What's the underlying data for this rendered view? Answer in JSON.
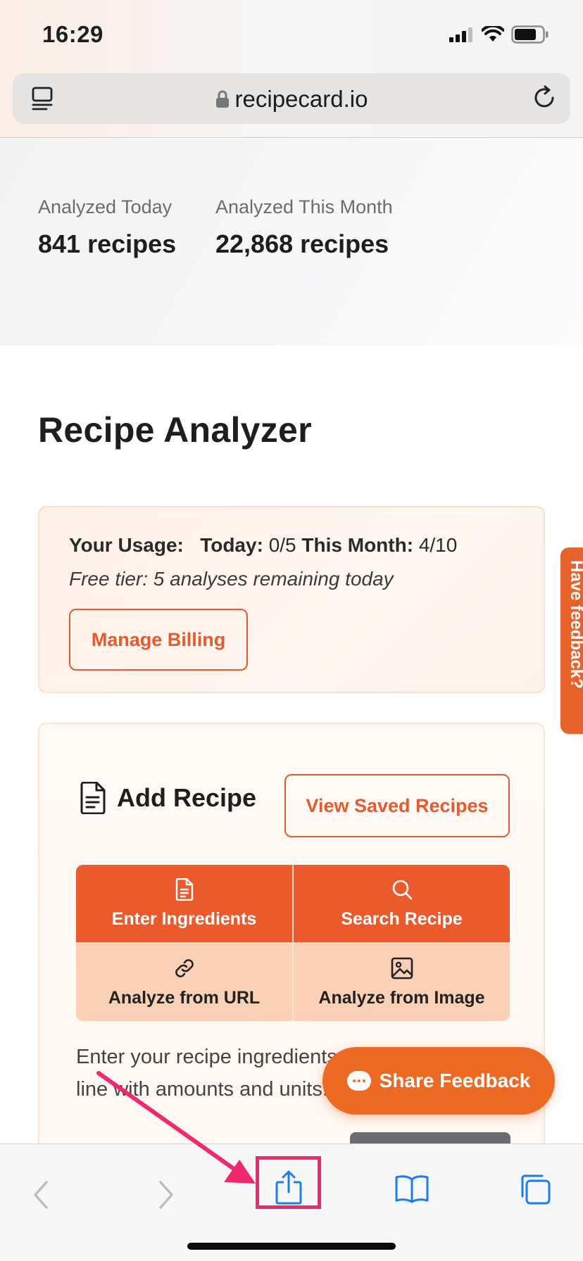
{
  "status": {
    "time": "16:29"
  },
  "browser": {
    "url": "recipecard.io"
  },
  "stats": [
    {
      "label": "Analyzed Today",
      "value": "841 recipes"
    },
    {
      "label": "Analyzed This Month",
      "value": "22,868 recipes"
    }
  ],
  "page": {
    "title": "Recipe Analyzer"
  },
  "usage": {
    "heading": "Your Usage:",
    "today_label": "Today:",
    "today_value": "0/5",
    "month_label": "This Month:",
    "month_value": "4/10",
    "free_tier": "Free tier: 5 analyses remaining today",
    "manage_billing": "Manage Billing"
  },
  "feedback_tab": "Have feedback?",
  "add_recipe": {
    "title": "Add Recipe",
    "view_saved": "View Saved Recipes",
    "tabs": [
      {
        "label": "Enter Ingredients",
        "icon": "document-icon",
        "active": true
      },
      {
        "label": "Search Recipe",
        "icon": "search-icon",
        "active": true
      },
      {
        "label": "Analyze from URL",
        "icon": "link-icon",
        "active": false
      },
      {
        "label": "Analyze from Image",
        "icon": "image-icon",
        "active": false
      }
    ],
    "instructions_line1": "Enter your recipe ingredients, one per",
    "instructions_line2": "line with amounts and units."
  },
  "share_feedback": "Share Feedback",
  "colors": {
    "accent": "#eb5a2c",
    "annotation": "#f0296e"
  }
}
